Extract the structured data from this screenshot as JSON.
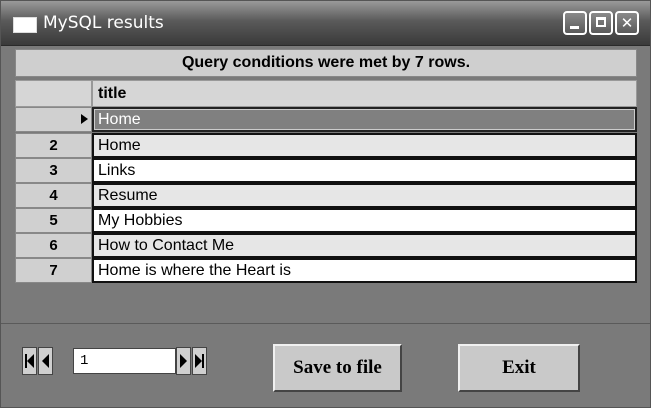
{
  "window": {
    "title": "MySQL results"
  },
  "banner": "Query conditions were met by 7 rows.",
  "grid": {
    "column_header": "title",
    "rows": [
      {
        "num": "",
        "title": "Home",
        "selected": true
      },
      {
        "num": "2",
        "title": "Home"
      },
      {
        "num": "3",
        "title": "Links"
      },
      {
        "num": "4",
        "title": "Resume"
      },
      {
        "num": "5",
        "title": "My Hobbies"
      },
      {
        "num": "6",
        "title": "How to Contact Me"
      },
      {
        "num": "7",
        "title": "Home is where the Heart is"
      }
    ]
  },
  "navigator": {
    "current_record": "1"
  },
  "buttons": {
    "save_label": "Save to file",
    "exit_label": "Exit"
  },
  "icons": [
    "app-window-icon",
    "minimize-icon",
    "maximize-icon",
    "close-icon",
    "first-record-icon",
    "prev-record-icon",
    "next-record-icon",
    "last-record-icon",
    "row-pointer-icon"
  ]
}
